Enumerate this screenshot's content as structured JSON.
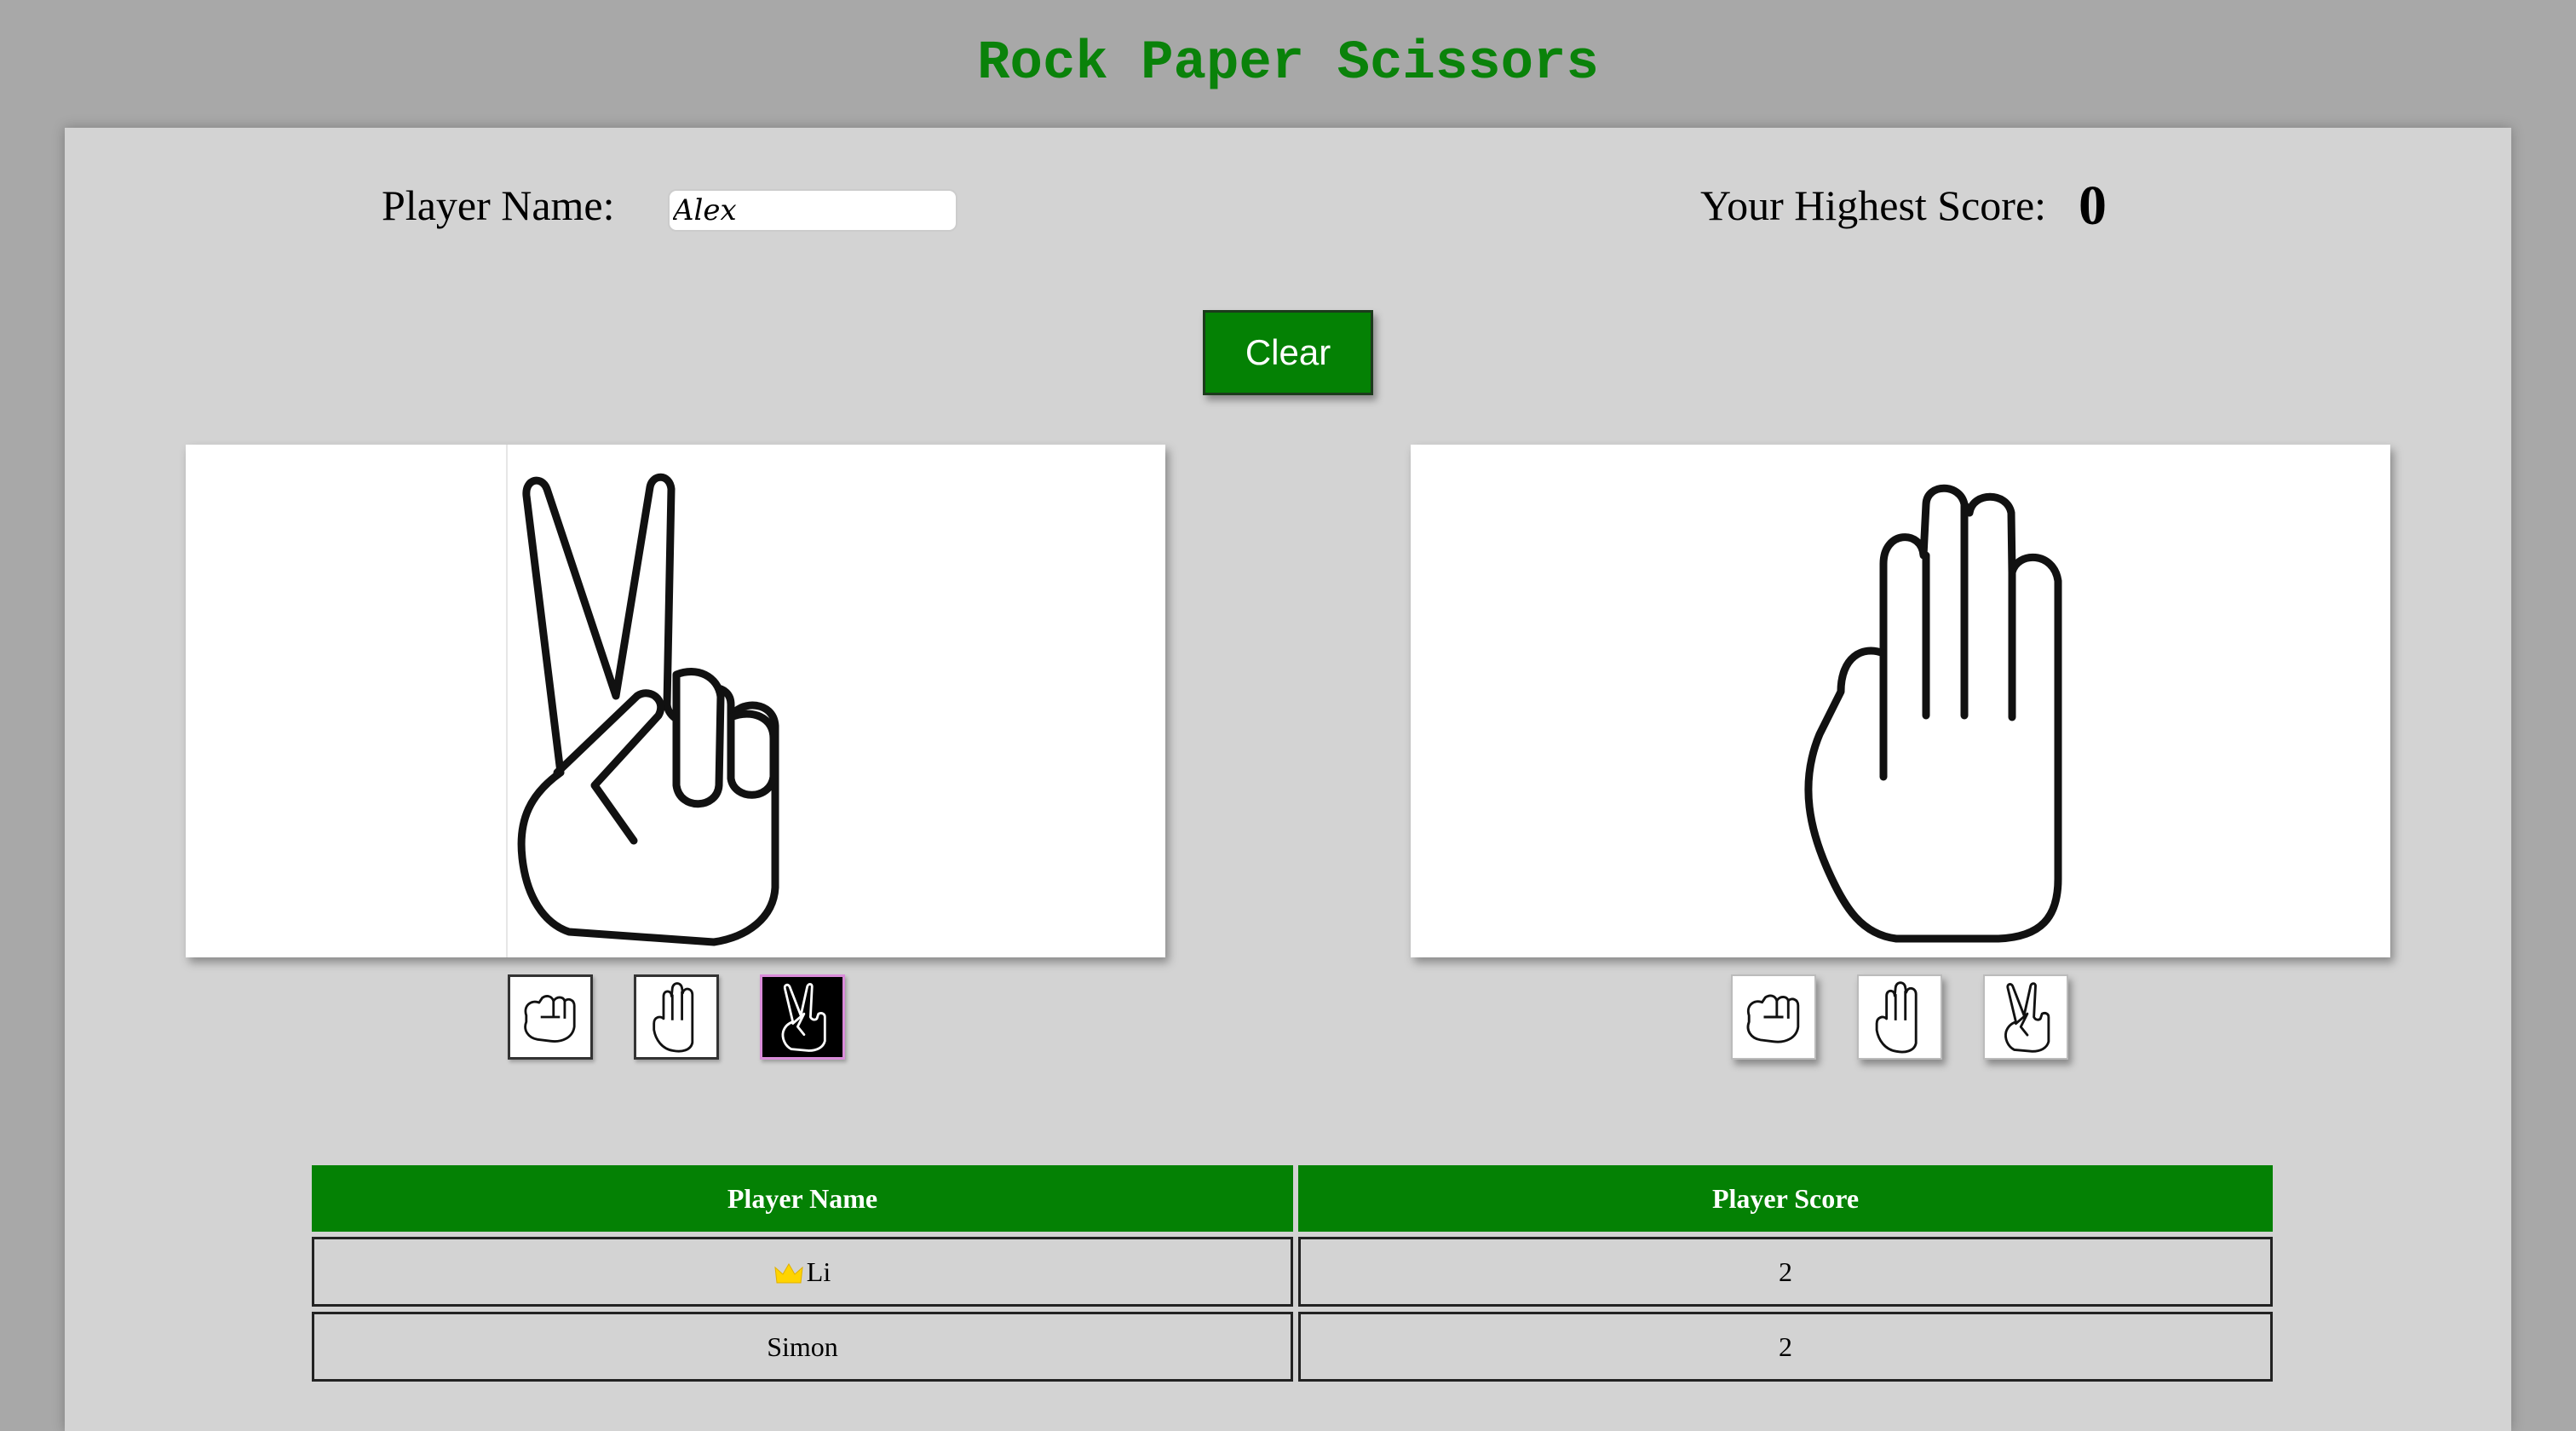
{
  "app": {
    "title": "Rock Paper Scissors"
  },
  "player": {
    "name_label": "Player Name:",
    "name_value": "Alex",
    "highest_score_label": "Your Highest Score:",
    "highest_score_value": "0"
  },
  "controls": {
    "clear_label": "Clear"
  },
  "player_board": {
    "shown_hand": "scissors-hand-icon",
    "selected_choice": "scissors",
    "choices": [
      "rock",
      "paper",
      "scissors"
    ]
  },
  "computer_board": {
    "shown_hand": "paper-hand-icon",
    "choices": [
      "rock",
      "paper",
      "scissors"
    ]
  },
  "leaderboard": {
    "headers": [
      "Player Name",
      "Player Score"
    ],
    "rows": [
      {
        "name": "Li",
        "score": "2",
        "leader_icon": "crown-icon"
      },
      {
        "name": "Simon",
        "score": "2"
      }
    ]
  },
  "colors": {
    "accent": "#048104",
    "title": "#0a820a",
    "background": "#a8a8a8",
    "panel": "#d3d3d3",
    "crown": "#ffd400",
    "selected_border": "#d98cd9"
  }
}
